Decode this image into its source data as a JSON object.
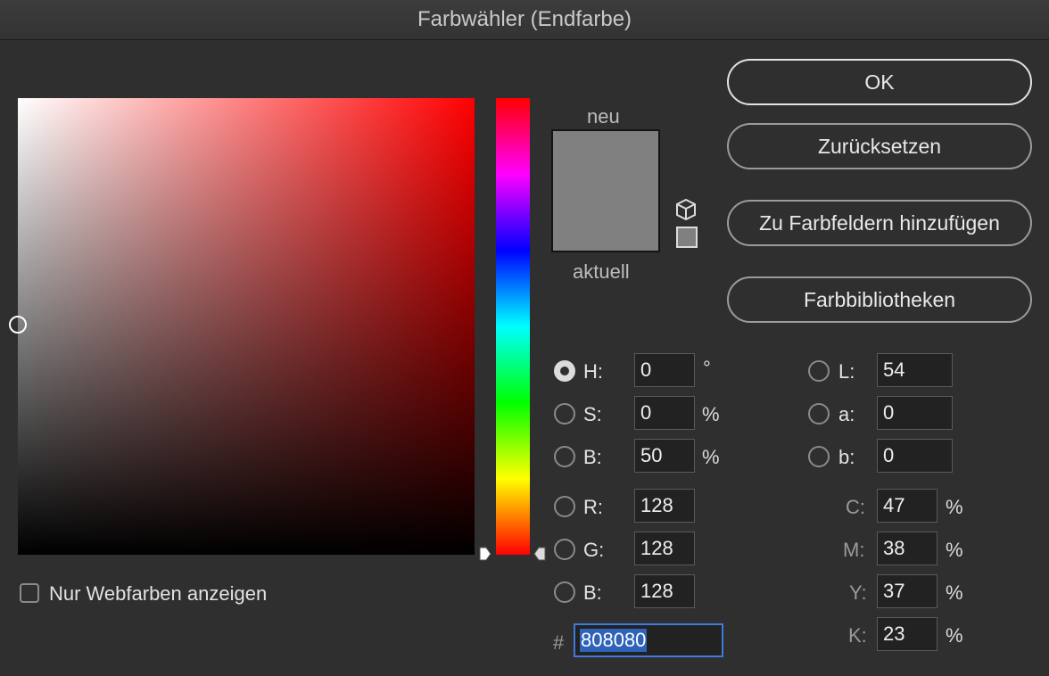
{
  "window": {
    "title": "Farbwähler (Endfarbe)"
  },
  "picker": {
    "mode": "hue",
    "field_hue_color": "#ff0000",
    "selected_color": "#808080"
  },
  "preview": {
    "new_label": "neu",
    "current_label": "aktuell",
    "new_color": "#808080",
    "current_color": "#808080",
    "gamut_icon": "cube-icon",
    "websafe_swatch_color": "#808080"
  },
  "buttons": {
    "ok": "OK",
    "reset": "Zurücksetzen",
    "add_to_swatches": "Zu Farbfeldern hinzufügen",
    "color_libraries": "Farbbibliotheken"
  },
  "hsb": {
    "h": {
      "label": "H:",
      "value": "0",
      "unit": "°",
      "checked": true
    },
    "s": {
      "label": "S:",
      "value": "0",
      "unit": "%",
      "checked": false
    },
    "b": {
      "label": "B:",
      "value": "50",
      "unit": "%",
      "checked": false
    }
  },
  "rgb": {
    "r": {
      "label": "R:",
      "value": "128",
      "checked": false
    },
    "g": {
      "label": "G:",
      "value": "128",
      "checked": false
    },
    "b": {
      "label": "B:",
      "value": "128",
      "checked": false
    }
  },
  "lab": {
    "l": {
      "label": "L:",
      "value": "54",
      "checked": false
    },
    "a": {
      "label": "a:",
      "value": "0",
      "checked": false
    },
    "b": {
      "label": "b:",
      "value": "0",
      "checked": false
    }
  },
  "cmyk": {
    "c": {
      "label": "C:",
      "value": "47",
      "unit": "%"
    },
    "m": {
      "label": "M:",
      "value": "38",
      "unit": "%"
    },
    "y": {
      "label": "Y:",
      "value": "37",
      "unit": "%"
    },
    "k": {
      "label": "K:",
      "value": "23",
      "unit": "%"
    }
  },
  "hex": {
    "prefix": "#",
    "value": "808080"
  },
  "webcolors": {
    "label": "Nur Webfarben anzeigen",
    "checked": false
  }
}
